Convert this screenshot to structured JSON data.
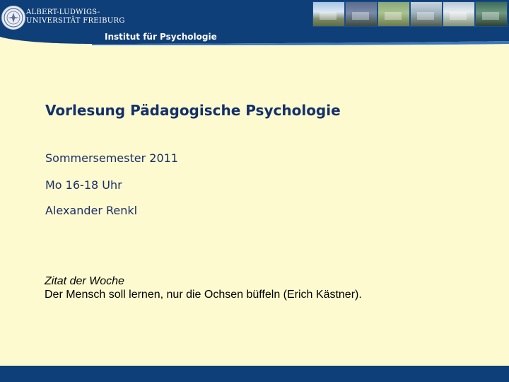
{
  "header": {
    "university_line1": "ALBERT-LUDWIGS-",
    "university_line2": "UNIVERSITÄT FREIBURG",
    "institute": "Institut für Psychologie",
    "brand_color": "#0f3f78",
    "photos": [
      "campus-building",
      "lecture-hall",
      "campus-trees",
      "campus-building",
      "campus-building",
      "computer-lab"
    ]
  },
  "slide": {
    "title": "Vorlesung Pädagogische Psychologie",
    "semester": "Sommersemester 2011",
    "time": "Mo 16-18 Uhr",
    "lecturer": "Alexander Renkl",
    "quote_heading": "Zitat der Woche",
    "quote_text": "Der Mensch soll lernen, nur die Ochsen büffeln (Erich Kästner).",
    "background_color": "#fdfad0",
    "title_color": "#14306a"
  }
}
